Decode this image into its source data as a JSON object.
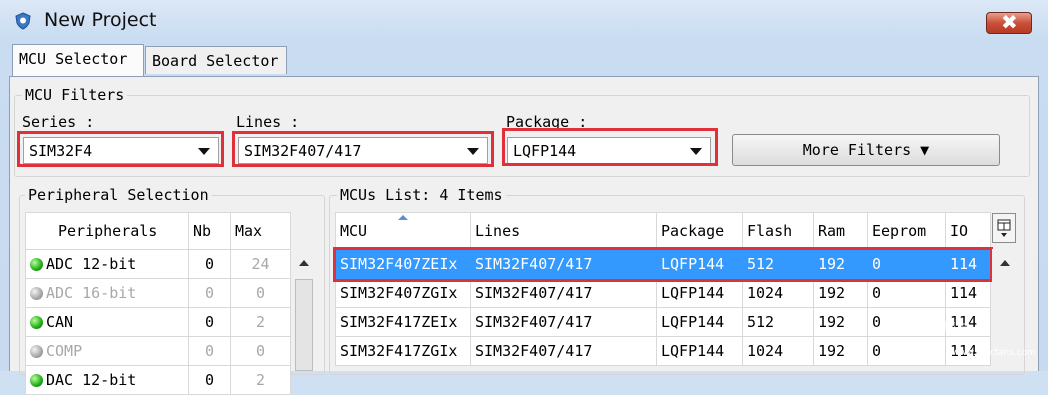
{
  "window": {
    "title": "New Project",
    "close_symbol": "✖"
  },
  "tabs": [
    {
      "label": "MCU Selector",
      "active": true
    },
    {
      "label": "Board Selector",
      "active": false
    }
  ],
  "filters": {
    "legend": "MCU Filters",
    "series": {
      "label": "Series :",
      "value": "SIM32F4"
    },
    "lines": {
      "label": "Lines :",
      "value": "SIM32F407/417"
    },
    "package": {
      "label": "Package :",
      "value": "LQFP144"
    },
    "more_filters": "More Filters ▼"
  },
  "peripherals": {
    "legend": "Peripheral Selection",
    "headers": {
      "name": "Peripherals",
      "nb": "Nb",
      "max": "Max"
    },
    "rows": [
      {
        "name": "ADC 12-bit",
        "nb": "0",
        "max": "24",
        "status": "green",
        "enabled": true
      },
      {
        "name": "ADC 16-bit",
        "nb": "0",
        "max": "0",
        "status": "gray",
        "enabled": false
      },
      {
        "name": "CAN",
        "nb": "0",
        "max": "2",
        "status": "green",
        "enabled": true
      },
      {
        "name": "COMP",
        "nb": "0",
        "max": "0",
        "status": "gray",
        "enabled": false
      },
      {
        "name": "DAC 12-bit",
        "nb": "0",
        "max": "2",
        "status": "green",
        "enabled": true
      }
    ]
  },
  "mcus": {
    "legend": "MCUs List: 4 Items",
    "headers": {
      "mcu": "MCU",
      "lines": "Lines",
      "package": "Package",
      "flash": "Flash",
      "ram": "Ram",
      "eeprom": "Eeprom",
      "io": "IO"
    },
    "rows": [
      {
        "mcu": "SIM32F407ZEIx",
        "lines": "SIM32F407/417",
        "package": "LQFP144",
        "flash": "512",
        "ram": "192",
        "eeprom": "0",
        "io": "114"
      },
      {
        "mcu": "SIM32F407ZGIx",
        "lines": "SIM32F407/417",
        "package": "LQFP144",
        "flash": "1024",
        "ram": "192",
        "eeprom": "0",
        "io": "114"
      },
      {
        "mcu": "SIM32F417ZEIx",
        "lines": "SIM32F407/417",
        "package": "LQFP144",
        "flash": "512",
        "ram": "192",
        "eeprom": "0",
        "io": "114"
      },
      {
        "mcu": "SIM32F417ZGIx",
        "lines": "SIM32F407/417",
        "package": "LQFP144",
        "flash": "1024",
        "ram": "192",
        "eeprom": "0",
        "io": "114"
      }
    ]
  },
  "watermark": {
    "line1": "电子发烧友",
    "line2": "www.elecfans.com"
  },
  "colors": {
    "selection": "#3399ff",
    "highlight": "#e0303a",
    "status_green": "#1faa16"
  }
}
